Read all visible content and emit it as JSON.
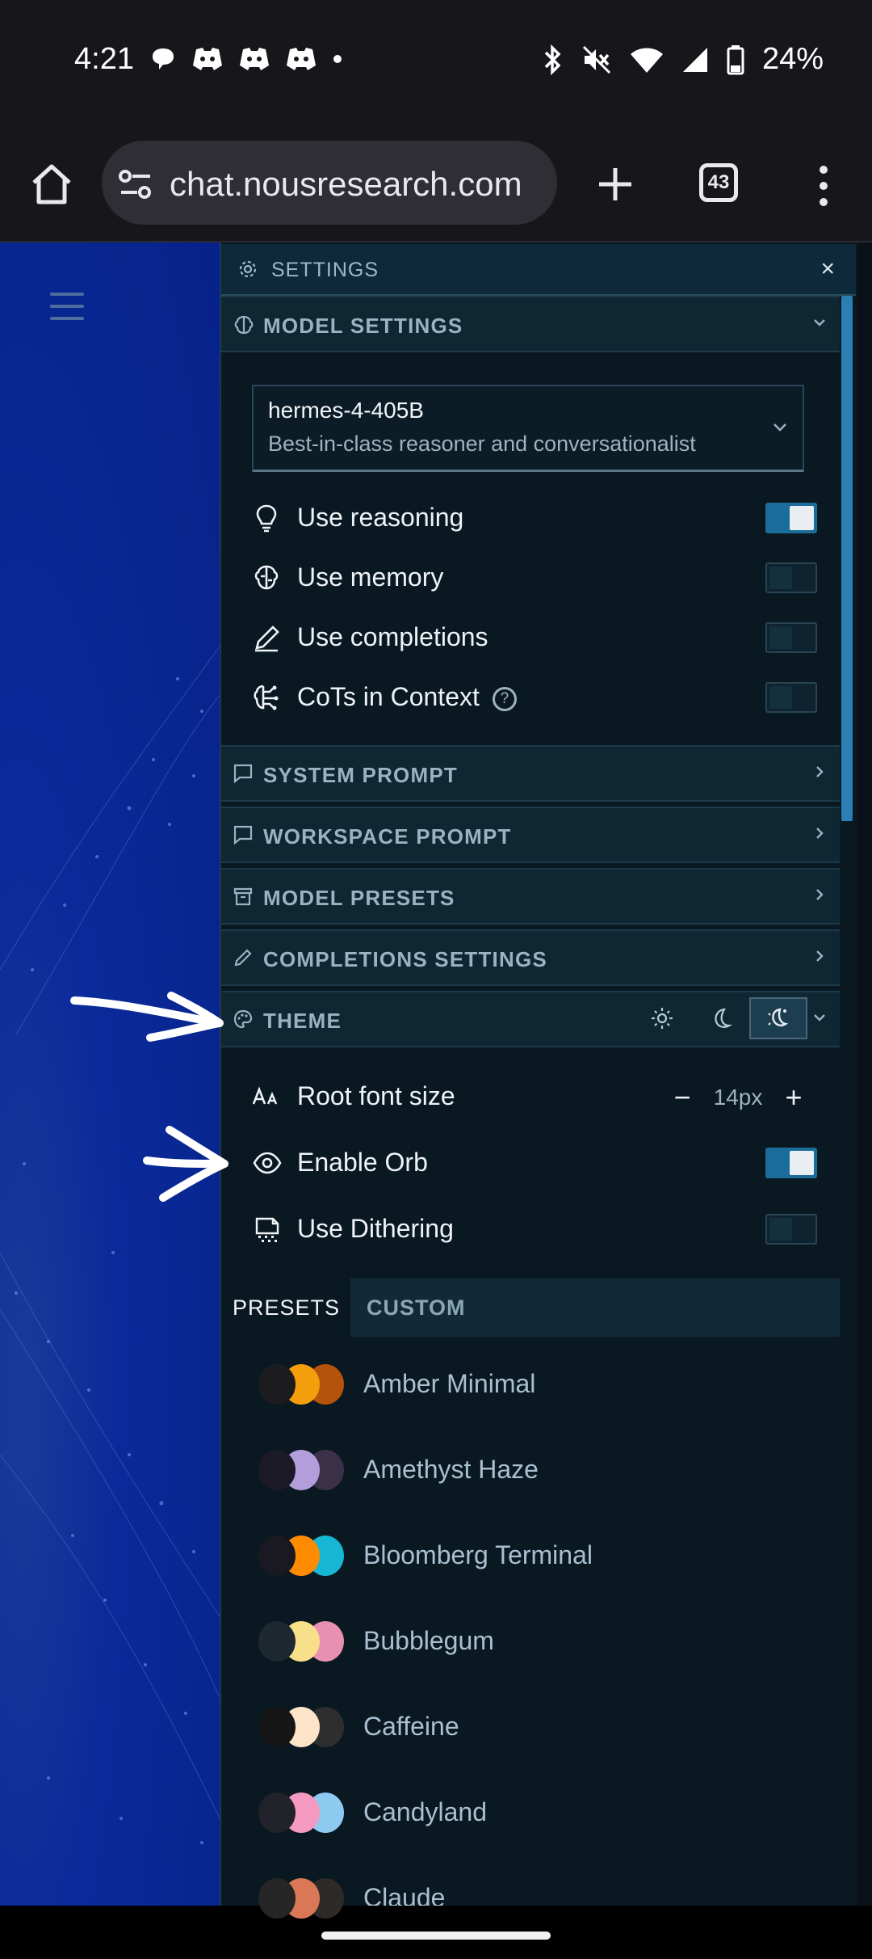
{
  "status_bar": {
    "time": "4:21",
    "battery": "24%",
    "notification_icons": [
      "chat-bubble-icon",
      "discord-icon",
      "discord-icon",
      "discord-icon",
      "dot-icon"
    ],
    "system_icons": [
      "bluetooth-icon",
      "mute-icon",
      "wifi-icon",
      "signal-icon",
      "battery-icon"
    ]
  },
  "browser": {
    "url": "chat.nousresearch.com",
    "tab_count": "43"
  },
  "panel": {
    "title": "SETTINGS",
    "close": "×"
  },
  "sections": {
    "model_settings": "MODEL SETTINGS",
    "system_prompt": "SYSTEM PROMPT",
    "workspace_prompt": "WORKSPACE PROMPT",
    "model_presets": "MODEL PRESETS",
    "completions_settings": "COMPLETIONS SETTINGS",
    "theme": "THEME"
  },
  "model": {
    "name": "hermes-4-405B",
    "description": "Best-in-class reasoner and conversationalist"
  },
  "model_options": [
    {
      "label": "Use reasoning",
      "on": true
    },
    {
      "label": "Use memory",
      "on": false
    },
    {
      "label": "Use completions",
      "on": false
    },
    {
      "label": "CoTs in Context",
      "on": false
    }
  ],
  "theme_options": {
    "root_font_size_label": "Root font size",
    "root_font_size_value": "14px",
    "minus": "−",
    "plus": "+",
    "enable_orb_label": "Enable Orb",
    "enable_orb_on": true,
    "use_dithering_label": "Use Dithering",
    "use_dithering_on": false,
    "help": "?"
  },
  "preset_tabs": {
    "presets": "PRESETS",
    "custom": "CUSTOM"
  },
  "themes": [
    {
      "name": "Amber Minimal",
      "colors": [
        "#1c1c1f",
        "#f59e0b",
        "#b45309"
      ]
    },
    {
      "name": "Amethyst Haze",
      "colors": [
        "#1c1a26",
        "#b39ddb",
        "#3a3048"
      ]
    },
    {
      "name": "Bloomberg Terminal",
      "colors": [
        "#1a1820",
        "#ff8c00",
        "#16b6d4"
      ]
    },
    {
      "name": "Bubblegum",
      "colors": [
        "#1e2830",
        "#f8e08a",
        "#e890b0"
      ]
    },
    {
      "name": "Caffeine",
      "colors": [
        "#161616",
        "#fde4c8",
        "#2e2e2e"
      ]
    },
    {
      "name": "Candyland",
      "colors": [
        "#22222a",
        "#f49ac1",
        "#8ec9f0"
      ]
    },
    {
      "name": "Claude",
      "colors": [
        "#262626",
        "#d97757",
        "#2e2a28"
      ]
    }
  ]
}
